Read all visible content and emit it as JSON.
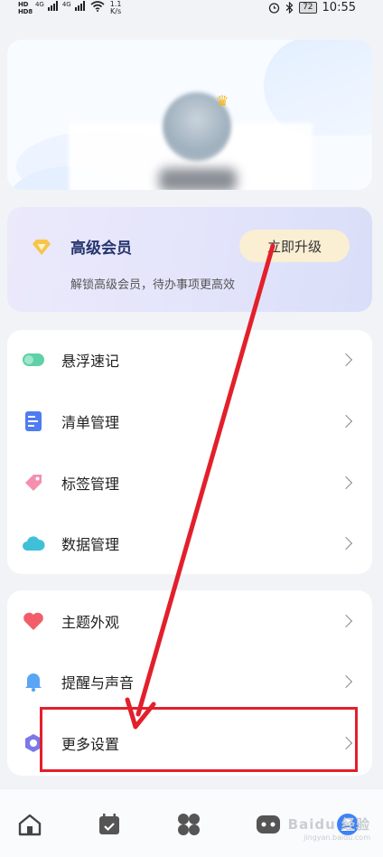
{
  "status_bar": {
    "network_left": "HD",
    "network_sub": "8",
    "signal_type": "4G",
    "speed_value": "1.1",
    "speed_unit": "K/s",
    "battery": "72",
    "time": "10:55"
  },
  "vip": {
    "title": "高级会员",
    "description": "解锁高级会员，待办事项更高效",
    "upgrade_label": "立即升级"
  },
  "menu_groups": [
    {
      "items": [
        {
          "label": "悬浮速记",
          "icon": "floating-note-icon"
        },
        {
          "label": "清单管理",
          "icon": "list-icon"
        },
        {
          "label": "标签管理",
          "icon": "tag-icon"
        },
        {
          "label": "数据管理",
          "icon": "cloud-icon"
        }
      ]
    },
    {
      "items": [
        {
          "label": "主题外观",
          "icon": "heart-icon"
        },
        {
          "label": "提醒与声音",
          "icon": "bell-icon"
        },
        {
          "label": "更多设置",
          "icon": "settings-icon"
        }
      ]
    }
  ],
  "bottom_nav": {
    "items": [
      "home-icon",
      "calendar-icon",
      "apps-icon",
      "robot-icon",
      "profile-icon"
    ],
    "watermark": "Baidu 经验",
    "watermark_sub": "jingyan.baidu.com"
  },
  "annotations": {
    "arrow_color": "#e2202b",
    "highlighted_item": "更多设置"
  },
  "colors": {
    "accent_red": "#e2202b",
    "vip_title": "#27356e",
    "upgrade_button": "#faeed3",
    "background": "#f1f3f7"
  }
}
